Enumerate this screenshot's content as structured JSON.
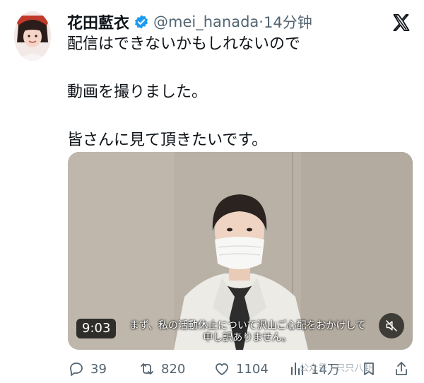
{
  "tweet": {
    "display_name": "花田藍衣",
    "handle": "@mei_hanada",
    "separator": "·",
    "time": "14分钟",
    "lines": [
      "配信はできないかもしれないので",
      "動画を撮りました。",
      "皆さんに見て頂きたいです。"
    ]
  },
  "video": {
    "timestamp": "9:03",
    "subtitle_line1": "まず、私の活動休止について沢山ご心配をおかけして",
    "subtitle_line2": "申し訳ありません。"
  },
  "actions": {
    "replies": "39",
    "reposts": "820",
    "likes": "1104",
    "views": "14万"
  },
  "watermark": "公众号 · 只只八卦",
  "icons": {
    "verified": "verified-badge-icon",
    "brand": "x-logo-icon",
    "mute": "volume-muted-icon",
    "reply": "reply-icon",
    "repost": "repost-icon",
    "like": "heart-icon",
    "views": "views-icon",
    "bookmark": "bookmark-icon",
    "share": "share-icon"
  },
  "colors": {
    "text": "#0f1419",
    "secondary": "#536471",
    "verified": "#1d9bf0",
    "video_background": "#b6aea3"
  }
}
